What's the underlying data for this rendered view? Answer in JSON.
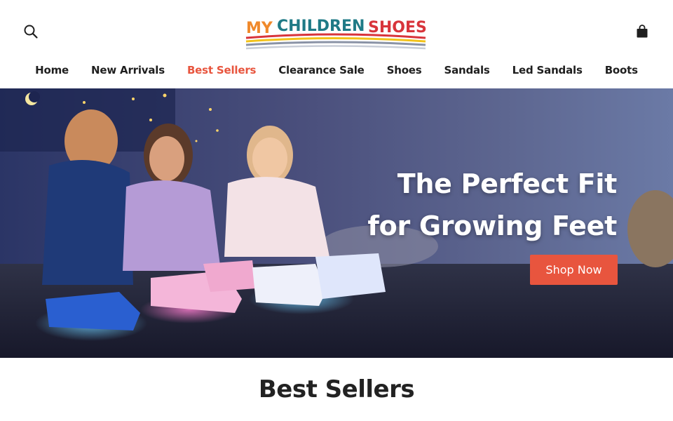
{
  "header": {
    "logo": {
      "text_part1": "MY",
      "text_part2": "CHILDREN",
      "text_part3": "SHOES",
      "colors": {
        "my": "#f0892b",
        "children": "#1f7a86",
        "shoes": "#d8343b",
        "swoosh_blue": "#3a5fa8",
        "swoosh_yellow": "#f2c21b",
        "swoosh_red": "#d8343b"
      }
    },
    "search_icon": "search-icon",
    "cart_icon": "shopping-bag-icon"
  },
  "nav": {
    "items": [
      {
        "label": "Home",
        "active": false
      },
      {
        "label": "New Arrivals",
        "active": false
      },
      {
        "label": "Best Sellers",
        "active": true
      },
      {
        "label": "Clearance Sale",
        "active": false
      },
      {
        "label": "Shoes",
        "active": false
      },
      {
        "label": "Sandals",
        "active": false
      },
      {
        "label": "Led Sandals",
        "active": false
      },
      {
        "label": "Boots",
        "active": false
      }
    ]
  },
  "hero": {
    "heading_line1": "The Perfect Fit",
    "heading_line2": "for Growing Feet",
    "cta_label": "Shop Now"
  },
  "section": {
    "title": "Best Sellers"
  },
  "colors": {
    "accent": "#e8553e",
    "text": "#1f1f1f"
  }
}
